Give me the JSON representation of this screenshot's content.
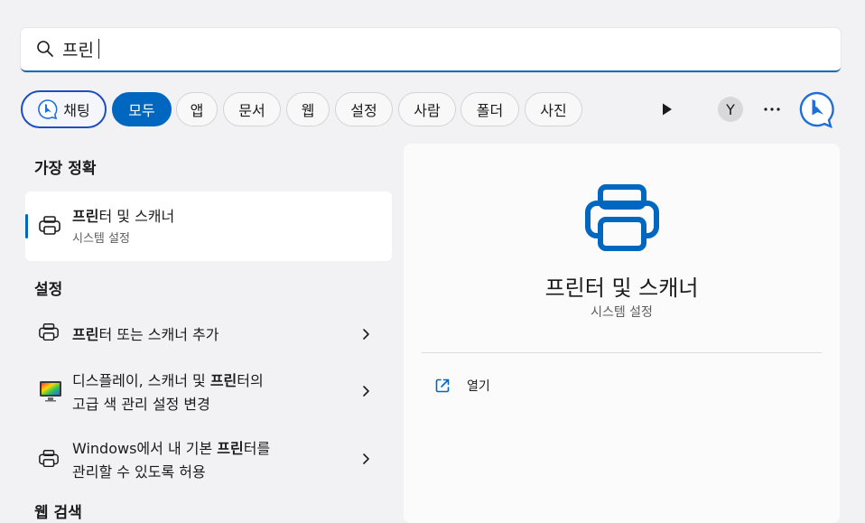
{
  "search": {
    "value": "프린"
  },
  "filters": {
    "chat": "채팅",
    "all": "모두",
    "apps": "앱",
    "documents": "문서",
    "web": "웹",
    "settings": "설정",
    "people": "사람",
    "folders": "폴더",
    "photos": "사진",
    "user_initial": "Y"
  },
  "best_match": {
    "header": "가장 정확",
    "item": {
      "title_bold": "프린",
      "title_rest": "터 및 스캐너",
      "subtitle": "시스템 설정"
    }
  },
  "settings_section": {
    "header": "설정",
    "items": [
      {
        "line1_pre": "",
        "line1_bold": "프린",
        "line1_post": "터 또는 스캐너 추가",
        "line2": ""
      },
      {
        "line1_pre": "디스플레이, 스캐너 및 ",
        "line1_bold": "프린",
        "line1_post": "터의",
        "line2": "고급 색 관리 설정 변경"
      },
      {
        "line1_pre": "Windows에서 내 기본 ",
        "line1_bold": "프린",
        "line1_post": "터를",
        "line2": "관리할 수 있도록 허용"
      }
    ]
  },
  "next_section_header": "웹 검색",
  "detail": {
    "title": "프린터 및 스캐너",
    "subtitle": "시스템 설정",
    "open_label": "열기"
  },
  "colors": {
    "accent": "#0067c0",
    "chat_border": "#1e4fbd",
    "search_underline": "#0f6cbd"
  },
  "icons": {
    "search": "search-icon",
    "printer": "printer-icon",
    "display": "display-color-icon",
    "chevron": "chevron-right-icon",
    "play": "play-icon",
    "more": "more-icon",
    "bing": "bing-chat-icon",
    "open": "open-external-icon"
  }
}
